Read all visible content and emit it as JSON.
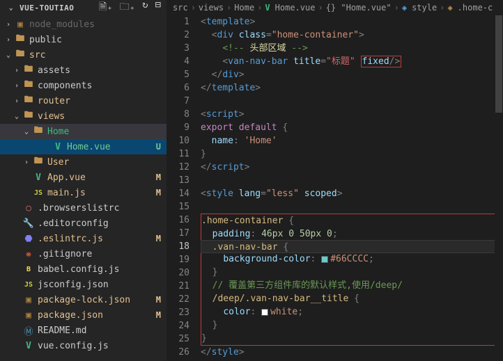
{
  "sidebar": {
    "title": "VUE-TOUTIAO",
    "items": [
      {
        "chev": "›",
        "indent": "pl-0",
        "icon": "📦",
        "label": "node_modules",
        "color": "dim"
      },
      {
        "chev": "›",
        "indent": "pl-0",
        "icon": "📁",
        "label": "public",
        "color": ""
      },
      {
        "chev": "⌄",
        "indent": "pl-0",
        "icon": "📁",
        "label": "src",
        "color": "lbl-mod"
      },
      {
        "chev": "›",
        "indent": "pl-1",
        "icon": "📁",
        "label": "assets",
        "color": ""
      },
      {
        "chev": "›",
        "indent": "pl-1",
        "icon": "📁",
        "label": "components",
        "color": ""
      },
      {
        "chev": "›",
        "indent": "pl-1",
        "icon": "📁",
        "label": "router",
        "color": "lbl-mod"
      },
      {
        "chev": "⌄",
        "indent": "pl-1",
        "icon": "📁",
        "label": "views",
        "color": "lbl-mod"
      },
      {
        "chev": "⌄",
        "indent": "pl-2",
        "icon": "📁",
        "label": "Home",
        "color": "lbl-teal",
        "active": true
      },
      {
        "chev": "",
        "indent": "pl-4",
        "icon": "V",
        "label": "Home.vue",
        "color": "lbl-untracked",
        "status": "U",
        "selected": true
      },
      {
        "chev": "›",
        "indent": "pl-2",
        "icon": "📁",
        "label": "User",
        "color": "lbl-mod"
      },
      {
        "chev": "",
        "indent": "pl-2",
        "icon": "V",
        "label": "App.vue",
        "color": "lbl-mod",
        "status": "M"
      },
      {
        "chev": "",
        "indent": "pl-2",
        "icon": "JS",
        "label": "main.js",
        "color": "lbl-mod",
        "status": "M"
      },
      {
        "chev": "",
        "indent": "pl-1",
        "icon": "○",
        "label": ".browserslistrc",
        "color": ""
      },
      {
        "chev": "",
        "indent": "pl-1",
        "icon": "🔧",
        "label": ".editorconfig",
        "color": ""
      },
      {
        "chev": "",
        "indent": "pl-1",
        "icon": "⬣",
        "label": ".eslintrc.js",
        "color": "lbl-mod",
        "status": "M"
      },
      {
        "chev": "",
        "indent": "pl-1",
        "icon": "❋",
        "label": ".gitignore",
        "color": ""
      },
      {
        "chev": "",
        "indent": "pl-1",
        "icon": "B",
        "label": "babel.config.js",
        "color": ""
      },
      {
        "chev": "",
        "indent": "pl-1",
        "icon": "JS",
        "label": "jsconfig.json",
        "color": ""
      },
      {
        "chev": "",
        "indent": "pl-1",
        "icon": "📦",
        "label": "package-lock.json",
        "color": "lbl-mod",
        "status": "M"
      },
      {
        "chev": "",
        "indent": "pl-1",
        "icon": "📦",
        "label": "package.json",
        "color": "lbl-mod",
        "status": "M"
      },
      {
        "chev": "",
        "indent": "pl-1",
        "icon": "Ⓜ",
        "label": "README.md",
        "color": ""
      },
      {
        "chev": "",
        "indent": "pl-1",
        "icon": "V",
        "label": "vue.config.js",
        "color": ""
      }
    ]
  },
  "breadcrumb": [
    "src",
    "views",
    "Home",
    "Home.vue",
    "{} \"Home.vue\"",
    "style",
    ".home-c"
  ],
  "editor": {
    "lines": [
      {
        "n": 1,
        "html": "<span class='p'>&lt;</span><span class='t'>template</span><span class='p'>&gt;</span>"
      },
      {
        "n": 2,
        "html": "  <span class='p'>&lt;</span><span class='t'>div</span> <span class='a'>class</span><span class='p'>=</span><span class='s'>\"home-container\"</span><span class='p'>&gt;</span>"
      },
      {
        "n": 3,
        "html": "    <span class='c'>&lt;!-- </span><span class='cy'>头部区域</span><span class='c'> --&gt;</span>"
      },
      {
        "n": 4,
        "html": "    <span class='p'>&lt;</span><span class='t'>van-nav-bar</span> <span class='a'>title</span><span class='p'>=</span><span class='sr'>\"标题\"</span> <span class='box-attr'><span class='a'>fixed</span><span class='p'>/&gt;</span></span>"
      },
      {
        "n": 5,
        "html": "  <span class='p'>&lt;/</span><span class='t'>div</span><span class='p'>&gt;</span>"
      },
      {
        "n": 6,
        "html": "<span class='p'>&lt;/</span><span class='t'>template</span><span class='p'>&gt;</span>"
      },
      {
        "n": 7,
        "html": ""
      },
      {
        "n": 8,
        "html": "<span class='p'>&lt;</span><span class='t'>script</span><span class='p'>&gt;</span>"
      },
      {
        "n": 9,
        "html": "<span class='k'>export</span> <span class='k'>default</span> <span class='p'>{</span>"
      },
      {
        "n": 10,
        "html": "  <span class='n'>name</span><span class='p'>:</span> <span class='s'>'Home'</span>"
      },
      {
        "n": 11,
        "html": "<span class='p'>}</span>"
      },
      {
        "n": 12,
        "html": "<span class='p'>&lt;/</span><span class='t'>script</span><span class='p'>&gt;</span>"
      },
      {
        "n": 13,
        "html": ""
      },
      {
        "n": 14,
        "html": "<span class='p'>&lt;</span><span class='t'>style</span> <span class='a'>lang</span><span class='p'>=</span><span class='s'>\"less\"</span> <span class='a'>scoped</span><span class='p'>&gt;</span>"
      },
      {
        "n": 15,
        "html": ""
      },
      {
        "n": 16,
        "box": "start",
        "html": "<span class='sel'>.home-container</span> <span class='p'>{</span>"
      },
      {
        "n": 17,
        "html": "  <span class='prop'>padding</span><span class='p'>:</span> <span class='num'>46px</span> <span class='num'>0</span> <span class='num'>50px</span> <span class='num'>0</span><span class='p'>;</span>"
      },
      {
        "n": 18,
        "active": true,
        "html": "  <span class='sel'>.van-nav-bar</span> <span class='p'>{</span>"
      },
      {
        "n": 19,
        "html": "    <span class='prop'>background-color</span><span class='p'>:</span> <span class='swatch' style='background:#66CCCC'></span><span class='s'>#66CCCC</span><span class='p'>;</span>"
      },
      {
        "n": 20,
        "html": "  <span class='p'>}</span>"
      },
      {
        "n": 21,
        "html": "  <span class='c'>// 覆盖第三方组件库的默认样式,使用/deep/</span>"
      },
      {
        "n": 22,
        "html": "  <span class='sel'>/deep/.van-nav-bar__title</span> <span class='p'>{</span>"
      },
      {
        "n": 23,
        "html": "    <span class='prop'>color</span><span class='p'>:</span> <span class='swatch' style='background:#fff'></span><span class='s'>white</span><span class='p'>;</span>"
      },
      {
        "n": 24,
        "html": "  <span class='p'>}</span>"
      },
      {
        "n": 25,
        "box": "end",
        "html": "<span class='p'>}</span>"
      },
      {
        "n": 26,
        "html": "<span class='p'>&lt;/</span><span class='t'>style</span><span class='p'>&gt;</span>"
      }
    ]
  }
}
